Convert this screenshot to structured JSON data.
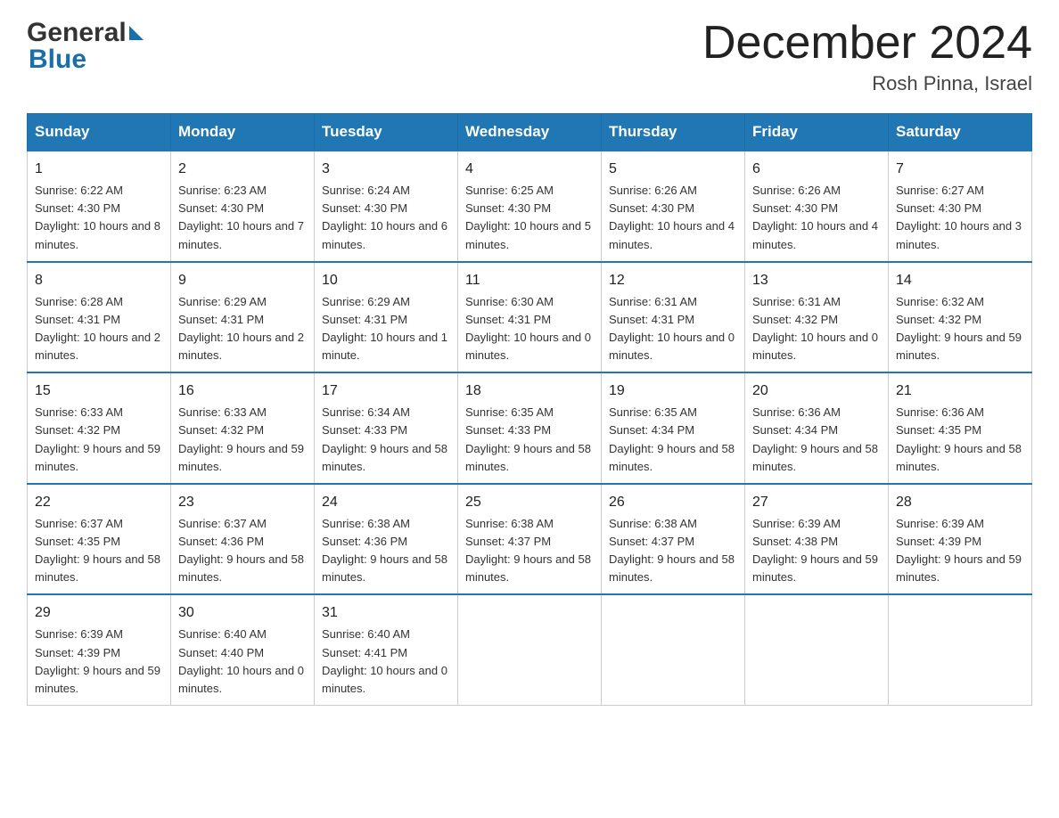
{
  "logo": {
    "general": "General",
    "blue": "Blue"
  },
  "title": "December 2024",
  "subtitle": "Rosh Pinna, Israel",
  "days_of_week": [
    "Sunday",
    "Monday",
    "Tuesday",
    "Wednesday",
    "Thursday",
    "Friday",
    "Saturday"
  ],
  "weeks": [
    [
      {
        "day": "1",
        "sunrise": "6:22 AM",
        "sunset": "4:30 PM",
        "daylight": "10 hours and 8 minutes."
      },
      {
        "day": "2",
        "sunrise": "6:23 AM",
        "sunset": "4:30 PM",
        "daylight": "10 hours and 7 minutes."
      },
      {
        "day": "3",
        "sunrise": "6:24 AM",
        "sunset": "4:30 PM",
        "daylight": "10 hours and 6 minutes."
      },
      {
        "day": "4",
        "sunrise": "6:25 AM",
        "sunset": "4:30 PM",
        "daylight": "10 hours and 5 minutes."
      },
      {
        "day": "5",
        "sunrise": "6:26 AM",
        "sunset": "4:30 PM",
        "daylight": "10 hours and 4 minutes."
      },
      {
        "day": "6",
        "sunrise": "6:26 AM",
        "sunset": "4:30 PM",
        "daylight": "10 hours and 4 minutes."
      },
      {
        "day": "7",
        "sunrise": "6:27 AM",
        "sunset": "4:30 PM",
        "daylight": "10 hours and 3 minutes."
      }
    ],
    [
      {
        "day": "8",
        "sunrise": "6:28 AM",
        "sunset": "4:31 PM",
        "daylight": "10 hours and 2 minutes."
      },
      {
        "day": "9",
        "sunrise": "6:29 AM",
        "sunset": "4:31 PM",
        "daylight": "10 hours and 2 minutes."
      },
      {
        "day": "10",
        "sunrise": "6:29 AM",
        "sunset": "4:31 PM",
        "daylight": "10 hours and 1 minute."
      },
      {
        "day": "11",
        "sunrise": "6:30 AM",
        "sunset": "4:31 PM",
        "daylight": "10 hours and 0 minutes."
      },
      {
        "day": "12",
        "sunrise": "6:31 AM",
        "sunset": "4:31 PM",
        "daylight": "10 hours and 0 minutes."
      },
      {
        "day": "13",
        "sunrise": "6:31 AM",
        "sunset": "4:32 PM",
        "daylight": "10 hours and 0 minutes."
      },
      {
        "day": "14",
        "sunrise": "6:32 AM",
        "sunset": "4:32 PM",
        "daylight": "9 hours and 59 minutes."
      }
    ],
    [
      {
        "day": "15",
        "sunrise": "6:33 AM",
        "sunset": "4:32 PM",
        "daylight": "9 hours and 59 minutes."
      },
      {
        "day": "16",
        "sunrise": "6:33 AM",
        "sunset": "4:32 PM",
        "daylight": "9 hours and 59 minutes."
      },
      {
        "day": "17",
        "sunrise": "6:34 AM",
        "sunset": "4:33 PM",
        "daylight": "9 hours and 58 minutes."
      },
      {
        "day": "18",
        "sunrise": "6:35 AM",
        "sunset": "4:33 PM",
        "daylight": "9 hours and 58 minutes."
      },
      {
        "day": "19",
        "sunrise": "6:35 AM",
        "sunset": "4:34 PM",
        "daylight": "9 hours and 58 minutes."
      },
      {
        "day": "20",
        "sunrise": "6:36 AM",
        "sunset": "4:34 PM",
        "daylight": "9 hours and 58 minutes."
      },
      {
        "day": "21",
        "sunrise": "6:36 AM",
        "sunset": "4:35 PM",
        "daylight": "9 hours and 58 minutes."
      }
    ],
    [
      {
        "day": "22",
        "sunrise": "6:37 AM",
        "sunset": "4:35 PM",
        "daylight": "9 hours and 58 minutes."
      },
      {
        "day": "23",
        "sunrise": "6:37 AM",
        "sunset": "4:36 PM",
        "daylight": "9 hours and 58 minutes."
      },
      {
        "day": "24",
        "sunrise": "6:38 AM",
        "sunset": "4:36 PM",
        "daylight": "9 hours and 58 minutes."
      },
      {
        "day": "25",
        "sunrise": "6:38 AM",
        "sunset": "4:37 PM",
        "daylight": "9 hours and 58 minutes."
      },
      {
        "day": "26",
        "sunrise": "6:38 AM",
        "sunset": "4:37 PM",
        "daylight": "9 hours and 58 minutes."
      },
      {
        "day": "27",
        "sunrise": "6:39 AM",
        "sunset": "4:38 PM",
        "daylight": "9 hours and 59 minutes."
      },
      {
        "day": "28",
        "sunrise": "6:39 AM",
        "sunset": "4:39 PM",
        "daylight": "9 hours and 59 minutes."
      }
    ],
    [
      {
        "day": "29",
        "sunrise": "6:39 AM",
        "sunset": "4:39 PM",
        "daylight": "9 hours and 59 minutes."
      },
      {
        "day": "30",
        "sunrise": "6:40 AM",
        "sunset": "4:40 PM",
        "daylight": "10 hours and 0 minutes."
      },
      {
        "day": "31",
        "sunrise": "6:40 AM",
        "sunset": "4:41 PM",
        "daylight": "10 hours and 0 minutes."
      },
      null,
      null,
      null,
      null
    ]
  ],
  "labels": {
    "sunrise": "Sunrise:",
    "sunset": "Sunset:",
    "daylight": "Daylight:"
  }
}
